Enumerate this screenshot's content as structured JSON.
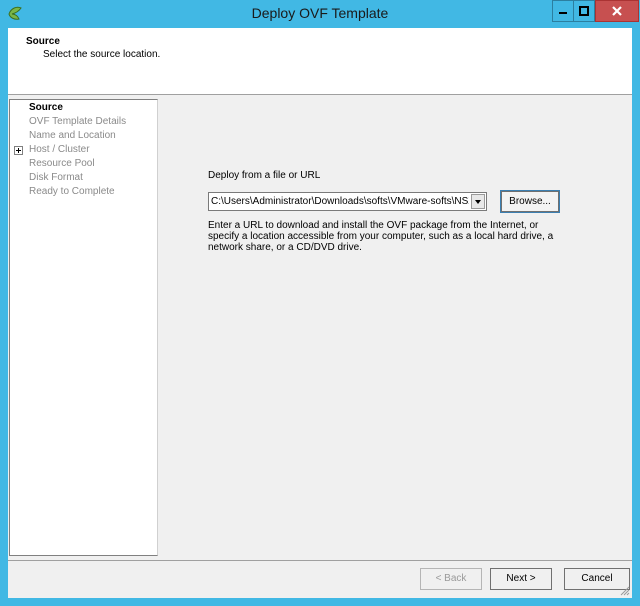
{
  "window": {
    "title": "Deploy OVF Template"
  },
  "header": {
    "title": "Source",
    "subtitle": "Select the source location."
  },
  "steps": [
    {
      "label": "Source",
      "active": true
    },
    {
      "label": "OVF Template Details",
      "active": false
    },
    {
      "label": "Name and Location",
      "active": false
    },
    {
      "label": "Host / Cluster",
      "active": false
    },
    {
      "label": "Resource Pool",
      "active": false
    },
    {
      "label": "Disk Format",
      "active": false
    },
    {
      "label": "Ready to Complete",
      "active": false
    }
  ],
  "source": {
    "label": "Deploy from a file or URL",
    "value": "C:\\Users\\Administrator\\Downloads\\softs\\VMware-softs\\NSX-",
    "browse_label": "Browse...",
    "description": "Enter a URL to download and install the OVF package from the Internet, or specify a location accessible from your computer, such as a local hard drive, a network share, or a CD/DVD drive."
  },
  "footer": {
    "back_label": "< Back",
    "next_label": "Next >",
    "cancel_label": "Cancel"
  },
  "colors": {
    "titlebar": "#41b8e4",
    "close_button": "#c75050"
  }
}
